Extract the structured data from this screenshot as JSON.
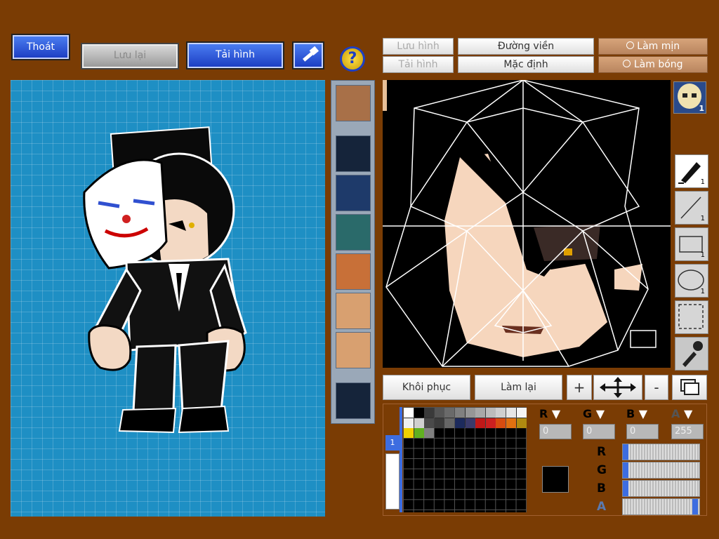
{
  "toolbar": {
    "exit_label": "Thoát",
    "save_label": "Lưu lại",
    "load_label": "Tải hình",
    "help_glyph": "?"
  },
  "editor_buttons": {
    "save_image": "Lưu hình",
    "load_image": "Tải hình",
    "outline": "Đường viền",
    "default": "Mặc định",
    "smooth": "Làm mịn",
    "shade": "Làm bóng",
    "restore": "Khôi phục",
    "redo": "Làm lại",
    "zoom_in": "+",
    "zoom_out": "-"
  },
  "tools": [
    {
      "icon": "pen-icon",
      "count": "1",
      "active": true
    },
    {
      "icon": "line-icon",
      "count": "1",
      "active": false
    },
    {
      "icon": "rectangle-icon",
      "count": "1",
      "active": false
    },
    {
      "icon": "ellipse-icon",
      "count": "1",
      "active": false
    },
    {
      "icon": "selection-icon",
      "count": "",
      "active": false
    },
    {
      "icon": "eyedropper-icon",
      "count": "",
      "active": false
    }
  ],
  "face_badge": "1",
  "color": {
    "r_label": "R",
    "g_label": "G",
    "b_label": "B",
    "a_label": "A",
    "r": "0",
    "g": "0",
    "b": "0",
    "a": "255",
    "r_fill": 0,
    "g_fill": 0,
    "b_fill": 0,
    "a_fill": 1,
    "current": "#000000"
  },
  "palette_tab": "1",
  "palette_row1": [
    "#ffffff",
    "#000000",
    "#3a3a3a",
    "#555555",
    "#6a6a6a",
    "#808080",
    "#969696",
    "#a8a8a8",
    "#bcbcbc",
    "#cfcfcf",
    "#e6e6e6",
    "#f5f5f5"
  ],
  "palette_row2": [
    "#f0f0f0",
    "#d0d0d0",
    "#4a4a4a",
    "#3c3c3c",
    "#666666",
    "#1c2a5c",
    "#3a3a6a",
    "#c01818",
    "#cc2020",
    "#d84c10",
    "#e07010",
    "#b08a10"
  ],
  "palette_row3": [
    "#f0d000",
    "#60b020",
    "#808080"
  ]
}
